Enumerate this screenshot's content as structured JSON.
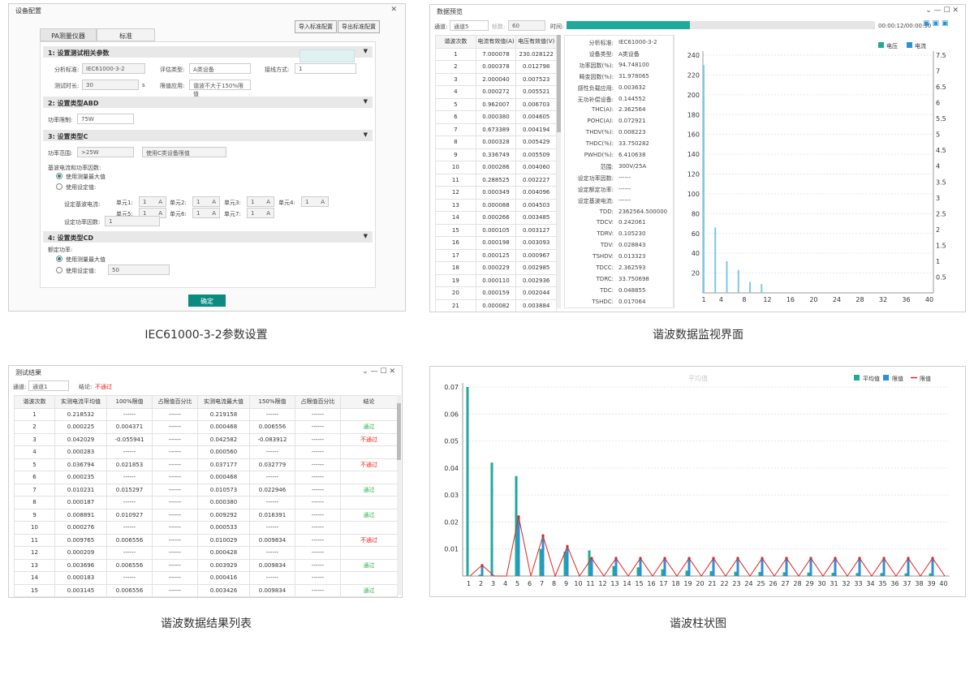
{
  "captions": {
    "p1": "IEC61000-3-2参数设置",
    "p2": "谐波数据监视界面",
    "p3": "谐波数据结果列表",
    "p4": "谐波柱状图"
  },
  "p1": {
    "title": "设备配置",
    "import": "导入标准配置",
    "export": "导出标准配置",
    "tab_pa": "PA测量仪器",
    "tab_std": "标准",
    "s1": "1:  设置测试相关参数",
    "s2": "2:  设置类型ABD",
    "s3": "3:  设置类型C",
    "s4": "4:  设置类型CD",
    "std_label": "分析标准:",
    "std_value": "IEC61000-3-2",
    "eval_label": "评估类型:",
    "eval_value": "A类设备",
    "wiring_label": "接线方式:",
    "wiring_value": "1",
    "dur_label": "测试时长:",
    "dur_value": "30",
    "dur_unit": "s",
    "limit_label": "限值应用:",
    "limit_value": "谐波不大于150%限值",
    "power_label": "功率限制:",
    "power_value": "75W",
    "range_label": "功率范围:",
    "range_value": ">25W",
    "c_mode": "使用C类设备限值",
    "base_label": "基波电流和功率因数:",
    "opt_max": "使用测量最大值",
    "opt_set": "使用设定值:",
    "base_cur": "设定基波电流:",
    "pf_label": "设定功率因数:",
    "pf_value": "1",
    "units": [
      "单元1:",
      "单元2:",
      "单元3:",
      "单元4:",
      "单元5:",
      "单元6:",
      "单元7:"
    ],
    "unit_val": "1",
    "unit_A": "A",
    "rated_label": "额定功率:",
    "opt_max2": "使用测量最大值",
    "opt_set2": "使用设定值:",
    "rated_value": "50",
    "ok": "确定",
    "wiring_icon": "▭"
  },
  "p2": {
    "title": "数据预览",
    "ch_label": "通道:",
    "ch_value": "通道5",
    "frame_label": "帧数:",
    "frame_value": "60",
    "time_label": "时间:",
    "time_text": "00:00:12/00:00:30",
    "progress": 0.4,
    "cols": [
      "谐波次数",
      "电流有效值(A)",
      "电压有效值(V)"
    ],
    "rows": [
      [
        "1",
        "7.000078",
        "230.028122"
      ],
      [
        "2",
        "0.000378",
        "0.012798"
      ],
      [
        "3",
        "2.000040",
        "0.007523"
      ],
      [
        "4",
        "0.000272",
        "0.005521"
      ],
      [
        "5",
        "0.962007",
        "0.006703"
      ],
      [
        "6",
        "0.000380",
        "0.004605"
      ],
      [
        "7",
        "0.673389",
        "0.004194"
      ],
      [
        "8",
        "0.000328",
        "0.005429"
      ],
      [
        "9",
        "0.336749",
        "0.005509"
      ],
      [
        "10",
        "0.000286",
        "0.004060"
      ],
      [
        "11",
        "0.288525",
        "0.002227"
      ],
      [
        "12",
        "0.000349",
        "0.004096"
      ],
      [
        "13",
        "0.000088",
        "0.004503"
      ],
      [
        "14",
        "0.000266",
        "0.003485"
      ],
      [
        "15",
        "0.000105",
        "0.003127"
      ],
      [
        "16",
        "0.000198",
        "0.003093"
      ],
      [
        "17",
        "0.000125",
        "0.000967"
      ],
      [
        "18",
        "0.000229",
        "0.002985"
      ],
      [
        "19",
        "0.000110",
        "0.002936"
      ],
      [
        "20",
        "0.000159",
        "0.002044"
      ],
      [
        "21",
        "0.000082",
        "0.003884"
      ]
    ],
    "info": [
      [
        "分析标准:",
        "IEC61000-3-2"
      ],
      [
        "设备类型:",
        "A类设备"
      ],
      [
        "功率因数(%):",
        "94.748100"
      ],
      [
        "畸变因数(%):",
        "31.978065"
      ],
      [
        "感性负载应用:",
        "0.003632"
      ],
      [
        "无功补偿设备:",
        "0.144552"
      ],
      [
        "THC(A):",
        "2.362564"
      ],
      [
        "POHC(A):",
        "0.072921"
      ],
      [
        "THDV(%):",
        "0.008223"
      ],
      [
        "THDC(%):",
        "33.750282"
      ],
      [
        "PWHD(%):",
        "6.410638"
      ],
      [
        "范围:",
        "300V/25A"
      ],
      [
        "设定功率因数:",
        "------"
      ],
      [
        "设定额定功率:",
        "------"
      ],
      [
        "设定基波电流:",
        "------"
      ],
      [
        "TDD:",
        "2362564.500000"
      ],
      [
        "TDCV:",
        "0.242061"
      ],
      [
        "TDRV:",
        "0.105230"
      ],
      [
        "TDV:",
        "0.028843"
      ],
      [
        "TSHDV:",
        "0.013323"
      ],
      [
        "TDCC:",
        "2.362593"
      ],
      [
        "TDRC:",
        "33.750698"
      ],
      [
        "TDC:",
        "0.048855"
      ],
      [
        "TSHDC:",
        "0.017064"
      ]
    ]
  },
  "p2chart": {
    "type": "bar",
    "legend": [
      "电压",
      "电流"
    ],
    "colors": [
      "#1fa99b",
      "#2d8fd5"
    ],
    "ylim": [
      0,
      240
    ],
    "y2lim": [
      0,
      7.5
    ],
    "yticks": [
      20,
      40,
      60,
      80,
      100,
      120,
      140,
      160,
      180,
      200,
      220,
      240
    ],
    "y2ticks": [
      "0.5",
      "1",
      "1.5",
      "2",
      "2.5",
      "3",
      "3.5",
      "4",
      "4.5",
      "5",
      "5.5",
      "6",
      "6.5",
      "7",
      "7.5"
    ],
    "xticks": [
      "1",
      "4",
      "8",
      "12",
      "16",
      "20",
      "24",
      "28",
      "32",
      "36",
      "40"
    ],
    "current": [
      {
        "x": 1,
        "v": 230
      },
      {
        "x": 3,
        "v": 66
      },
      {
        "x": 5,
        "v": 32
      },
      {
        "x": 7,
        "v": 23
      },
      {
        "x": 9,
        "v": 11
      },
      {
        "x": 11,
        "v": 9
      },
      {
        "x": 38,
        "v": 0.5
      },
      {
        "x": 39,
        "v": 0.5
      }
    ]
  },
  "p3": {
    "title": "测试结果",
    "ch_label": "通道:",
    "ch_value": "通道1",
    "verdict_label": "结论:",
    "verdict_value": "不通过",
    "cols": [
      "谐波次数",
      "实测电流平均值",
      "100%限值",
      "占限值百分比",
      "实测电流最大值",
      "150%限值",
      "占限值百分比",
      "结论"
    ],
    "rows": [
      [
        "1",
        "0.218532",
        "------",
        "------",
        "0.219158",
        "------",
        "------",
        ""
      ],
      [
        "2",
        "0.000225",
        "0.004371",
        "------",
        "0.000468",
        "0.006556",
        "------",
        "通过"
      ],
      [
        "3",
        "0.042029",
        "-0.055941",
        "------",
        "0.042582",
        "-0.083912",
        "------",
        "不通过"
      ],
      [
        "4",
        "0.000283",
        "------",
        "------",
        "0.000560",
        "------",
        "------",
        ""
      ],
      [
        "5",
        "0.036794",
        "0.021853",
        "------",
        "0.037177",
        "0.032779",
        "------",
        "不通过"
      ],
      [
        "6",
        "0.000235",
        "------",
        "------",
        "0.000468",
        "------",
        "------",
        ""
      ],
      [
        "7",
        "0.010231",
        "0.015297",
        "------",
        "0.010573",
        "0.022946",
        "------",
        "通过"
      ],
      [
        "8",
        "0.000187",
        "------",
        "------",
        "0.000380",
        "------",
        "------",
        ""
      ],
      [
        "9",
        "0.008891",
        "0.010927",
        "------",
        "0.009292",
        "0.016391",
        "------",
        "通过"
      ],
      [
        "10",
        "0.000276",
        "------",
        "------",
        "0.000533",
        "------",
        "------",
        ""
      ],
      [
        "11",
        "0.009765",
        "0.006556",
        "------",
        "0.010029",
        "0.009834",
        "------",
        "不通过"
      ],
      [
        "12",
        "0.000209",
        "------",
        "------",
        "0.000428",
        "------",
        "------",
        ""
      ],
      [
        "13",
        "0.003696",
        "0.006556",
        "------",
        "0.003929",
        "0.009834",
        "------",
        "通过"
      ],
      [
        "14",
        "0.000183",
        "------",
        "------",
        "0.000416",
        "------",
        "------",
        ""
      ],
      [
        "15",
        "0.003145",
        "0.006556",
        "------",
        "0.003426",
        "0.009834",
        "------",
        "通过"
      ]
    ]
  },
  "p4chart": {
    "type": "bar",
    "title": "平均值",
    "legend": [
      "平均值",
      "限值",
      "限值"
    ],
    "colors": [
      "#1fa99b",
      "#2d8fd5",
      "#e8231b"
    ],
    "ylim": [
      0,
      0.07
    ],
    "yticks": [
      "0.01",
      "0.02",
      "0.03",
      "0.04",
      "0.05",
      "0.06",
      "0.07"
    ],
    "x": [
      "1",
      "2",
      "3",
      "4",
      "5",
      "6",
      "7",
      "8",
      "9",
      "10",
      "11",
      "12",
      "13",
      "14",
      "15",
      "16",
      "17",
      "18",
      "19",
      "20",
      "21",
      "22",
      "23",
      "24",
      "25",
      "26",
      "27",
      "28",
      "29",
      "30",
      "31",
      "32",
      "33",
      "34",
      "35",
      "36",
      "37",
      "38",
      "39",
      "40"
    ],
    "avg": [
      0.07,
      0.0005,
      0.042,
      0,
      0.037,
      0,
      0.01,
      0,
      0.009,
      0,
      0.0095,
      0,
      0.0037,
      0,
      0.0032,
      0,
      0.0025,
      0,
      0.002,
      0,
      0.0018,
      0,
      0.0016,
      0,
      0.0015,
      0,
      0.0014,
      0,
      0.0013,
      0,
      0.0012,
      0,
      0.0011,
      0,
      0.0011,
      0,
      0.001,
      0,
      0.001,
      0
    ],
    "limit": [
      0,
      0.004,
      0,
      0,
      0.022,
      0,
      0.015,
      0,
      0.011,
      0,
      0.0066,
      0,
      0.0066,
      0,
      0.0066,
      0,
      0.0066,
      0,
      0.0066,
      0,
      0.0066,
      0,
      0.0066,
      0,
      0.0066,
      0,
      0.0066,
      0,
      0.0066,
      0,
      0.0066,
      0,
      0.0066,
      0,
      0.0066,
      0,
      0.0066,
      0,
      0.0066,
      0
    ]
  }
}
